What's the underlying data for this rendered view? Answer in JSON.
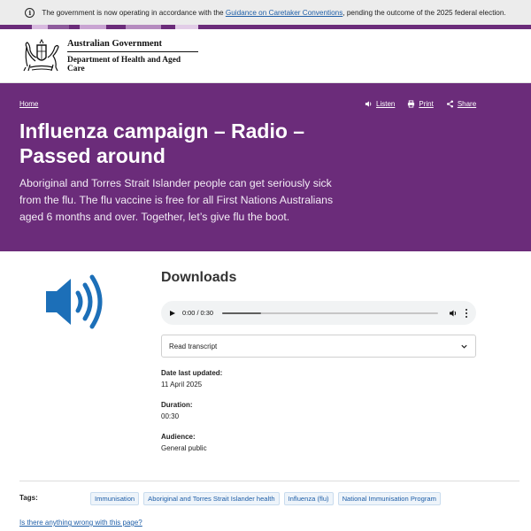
{
  "notice": {
    "before": "The government is now operating in accordance with the ",
    "link": "Guidance on Caretaker Conventions",
    "after": ", pending the outcome of the 2025 federal election."
  },
  "header": {
    "government": "Australian Government",
    "department": "Department of Health and Aged Care"
  },
  "hero": {
    "breadcrumb": "Home",
    "actions": {
      "listen": "Listen",
      "print": "Print",
      "share": "Share"
    },
    "title": "Influenza campaign – Radio – Passed around",
    "description": "Aboriginal and Torres Strait Islander people can get seriously sick from the flu. The flu vaccine is free for all First Nations Australians aged 6 months and over. Together, let’s give flu the boot."
  },
  "downloads": {
    "heading": "Downloads",
    "player": {
      "time": "0:00 / 0:30",
      "progress": 0.18
    },
    "transcript_label": "Read transcript"
  },
  "meta": {
    "date_label": "Date last updated:",
    "date_value": "11 April 2025",
    "duration_label": "Duration:",
    "duration_value": "00:30",
    "audience_label": "Audience:",
    "audience_value": "General public"
  },
  "tags": {
    "label": "Tags:",
    "items": [
      "Immunisation",
      "Aboriginal and Torres Strait Islander health",
      "Influenza (flu)",
      "National Immunisation Program"
    ]
  },
  "feedback_link": "Is there anything wrong with this page?",
  "colors": {
    "brand_purple": "#6b2c7a",
    "link_blue": "#1f5fa8",
    "speaker_blue": "#1c6fb8"
  }
}
